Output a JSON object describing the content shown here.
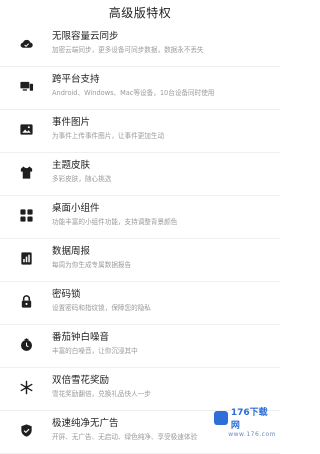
{
  "header": {
    "title": "高级版特权"
  },
  "items": [
    {
      "title": "无限容量云同步",
      "subtitle": "加密云端同步，更多设备可同步数据，数据永不丢失",
      "icon": "cloud-sync-icon"
    },
    {
      "title": "跨平台支持",
      "subtitle": "Android、Windows、Mac等设备，10台设备同时使用",
      "icon": "cross-platform-icon"
    },
    {
      "title": "事件图片",
      "subtitle": "为事件上传事件图片，让事件更加生动",
      "icon": "image-icon"
    },
    {
      "title": "主题皮肤",
      "subtitle": "多彩皮肤，随心挑选",
      "icon": "theme-icon"
    },
    {
      "title": "桌面小组件",
      "subtitle": "功能丰富的小组件功能，支持调整背景颜色",
      "icon": "widget-icon"
    },
    {
      "title": "数据周报",
      "subtitle": "每周为你生成专属数据报告",
      "icon": "report-icon"
    },
    {
      "title": "密码锁",
      "subtitle": "设置密码和指纹锁，保障您的隐私",
      "icon": "lock-icon"
    },
    {
      "title": "番茄钟白噪音",
      "subtitle": "丰富的白噪音，让你沉浸其中",
      "icon": "pomodoro-icon"
    },
    {
      "title": "双倍雪花奖励",
      "subtitle": "雪花奖励翻倍，兑换礼品快人一步",
      "icon": "snowflake-icon"
    },
    {
      "title": "极速纯净无广告",
      "subtitle": "开屏、无广告、无启动、绿色纯净、享受极速体验",
      "icon": "no-ads-icon"
    }
  ],
  "watermark": {
    "brand": "176下载网",
    "sub": "www.176.com"
  },
  "colors": {
    "icon": "#1f1f1f",
    "subtitle": "#9a9a9a",
    "watermark": "#2d6fd6"
  }
}
